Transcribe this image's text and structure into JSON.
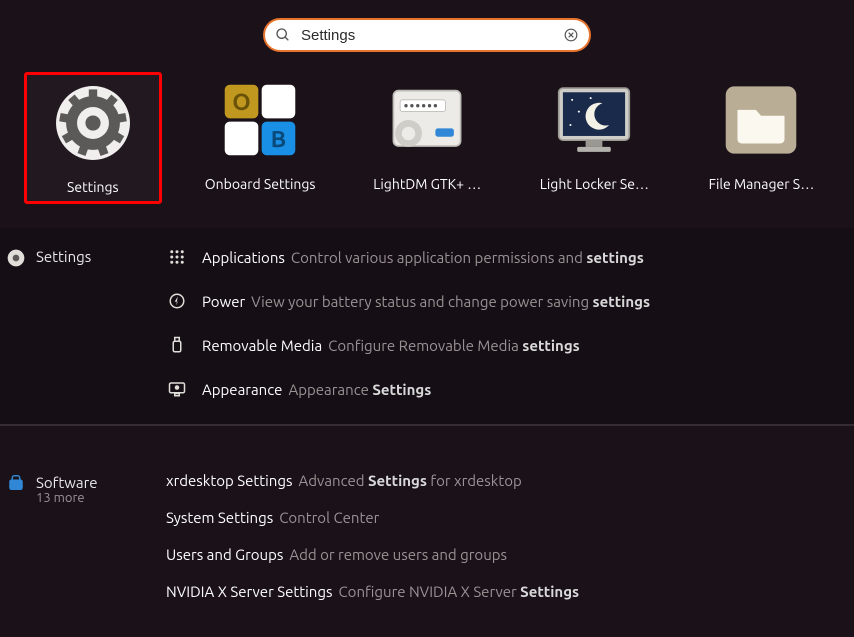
{
  "search": {
    "value": "Settings"
  },
  "apps": [
    {
      "label": "Settings"
    },
    {
      "label": "Onboard Settings"
    },
    {
      "label": "LightDM GTK+ …"
    },
    {
      "label": "Light Locker Se…"
    },
    {
      "label": "File Manager S…"
    }
  ],
  "settingsSection": {
    "header": "Settings",
    "items": [
      {
        "title": "Applications",
        "desc_pre": "Control various application permissions and ",
        "desc_bold": "settings",
        "desc_post": ""
      },
      {
        "title": "Power",
        "desc_pre": "View your battery status and change power saving ",
        "desc_bold": "settings",
        "desc_post": ""
      },
      {
        "title": "Removable Media",
        "desc_pre": "Configure Removable Media ",
        "desc_bold": "settings",
        "desc_post": ""
      },
      {
        "title": "Appearance",
        "desc_pre": "Appearance ",
        "desc_bold": "Settings",
        "desc_post": ""
      }
    ]
  },
  "softwareSection": {
    "header": "Software",
    "sub": "13 more",
    "items": [
      {
        "title": "xrdesktop Settings",
        "desc_pre": "Advanced ",
        "desc_bold": "Settings",
        "desc_post": " for xrdesktop"
      },
      {
        "title": "System Settings",
        "desc_pre": "Control Center",
        "desc_bold": "",
        "desc_post": ""
      },
      {
        "title": "Users and Groups",
        "desc_pre": "Add or remove users and groups",
        "desc_bold": "",
        "desc_post": ""
      },
      {
        "title": "NVIDIA X Server Settings",
        "desc_pre": "Configure NVIDIA X Server ",
        "desc_bold": "Settings",
        "desc_post": ""
      }
    ]
  }
}
